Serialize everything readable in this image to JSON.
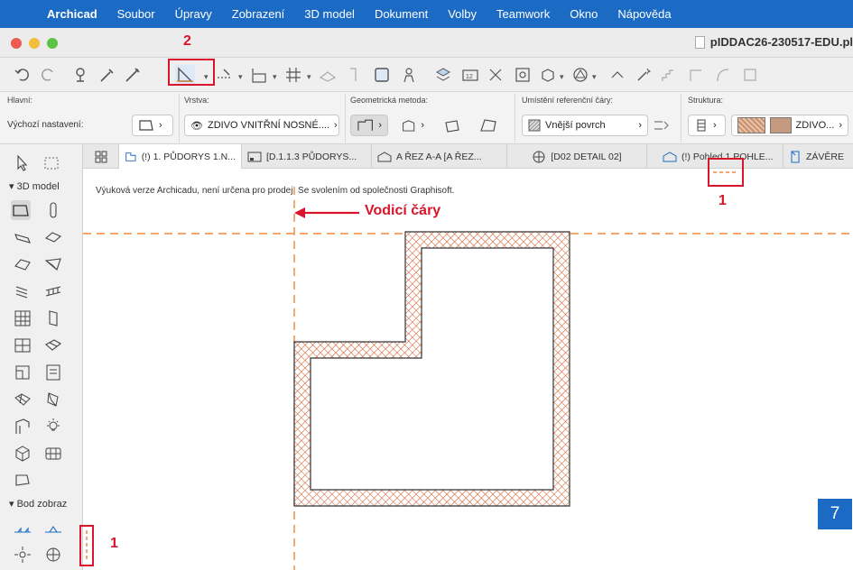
{
  "menubar": {
    "app": "Archicad",
    "items": [
      "Soubor",
      "Úpravy",
      "Zobrazení",
      "3D model",
      "Dokument",
      "Volby",
      "Teamwork",
      "Okno",
      "Nápověda"
    ]
  },
  "window": {
    "title": "pIDDAC26-230517-EDU.pl"
  },
  "infobox": {
    "hlavni_label": "Hlavní:",
    "default_settings": "Výchozí nastavení:",
    "layer_label": "Vrstva:",
    "layer_value": "ZDIVO VNITŘNÍ NOSNÉ....",
    "geometry_label": "Geometrická metoda:",
    "reference_label": "Umístění referenční čáry:",
    "reference_value": "Vnější povrch",
    "structure_label": "Struktura:",
    "structure_value": "ZDIVO..."
  },
  "tabs": [
    {
      "label": "(!) 1. PŮDORYS 1.N..."
    },
    {
      "label": "[D.1.1.3 PŮDORYS..."
    },
    {
      "label": "A ŘEZ A-A [A ŘEZ..."
    },
    {
      "label": "[D02 DETAIL 02]"
    },
    {
      "label": "(!) Pohled 1 POHLE..."
    },
    {
      "label": "ZÁVĚRE"
    }
  ],
  "toolbox": {
    "section_3d": "3D model",
    "section_bod": "Bod zobraz"
  },
  "canvas": {
    "watermark": "Výuková verze Archicadu, není určena pro prodej. Se svolením od společnosti Graphisoft.",
    "guide_label": "Vodicí čáry"
  },
  "annotations": {
    "n1": "1",
    "n2": "2",
    "n7": "7"
  },
  "colors": {
    "accent_blue": "#1b6bc4",
    "annotation_red": "#d8152c",
    "guide_orange": "#f0883a",
    "hatch": "#d05a2a"
  }
}
